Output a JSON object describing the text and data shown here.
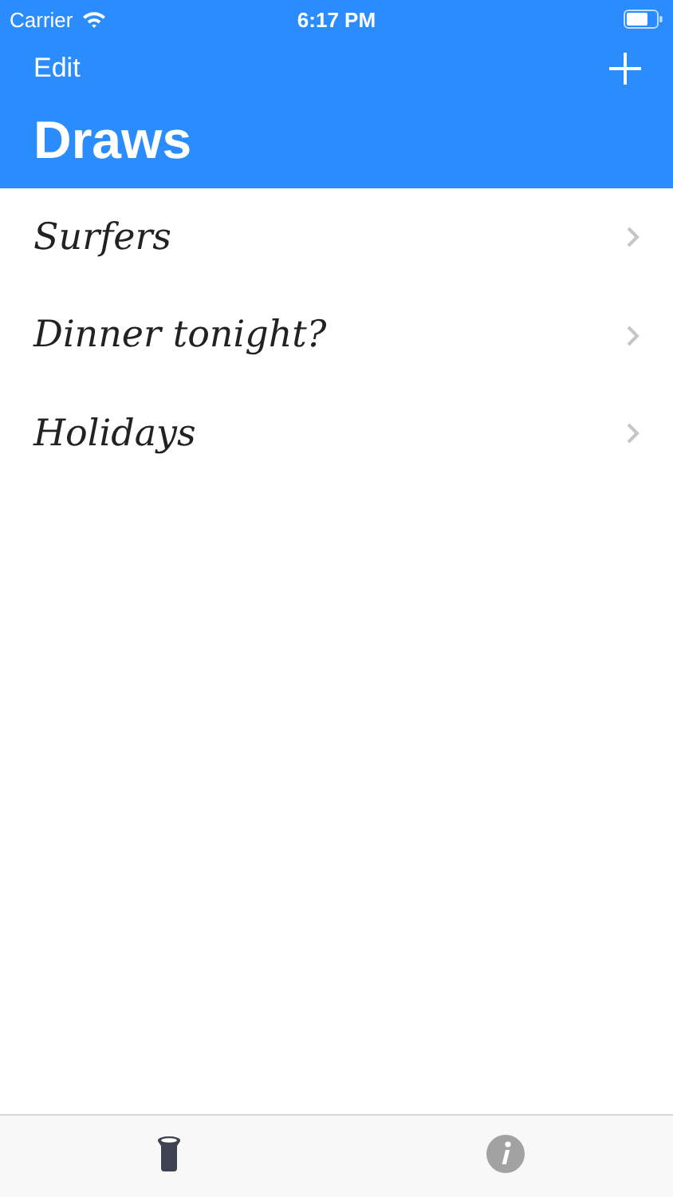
{
  "status_bar": {
    "carrier": "Carrier",
    "time": "6:17 PM"
  },
  "nav": {
    "edit": "Edit",
    "title": "Draws"
  },
  "rows": [
    {
      "title": "Surfers"
    },
    {
      "title": "Dinner tonight?"
    },
    {
      "title": "Holidays"
    }
  ],
  "tabs": [
    {
      "kind": "hat",
      "selected": true
    },
    {
      "kind": "info",
      "selected": false
    }
  ]
}
